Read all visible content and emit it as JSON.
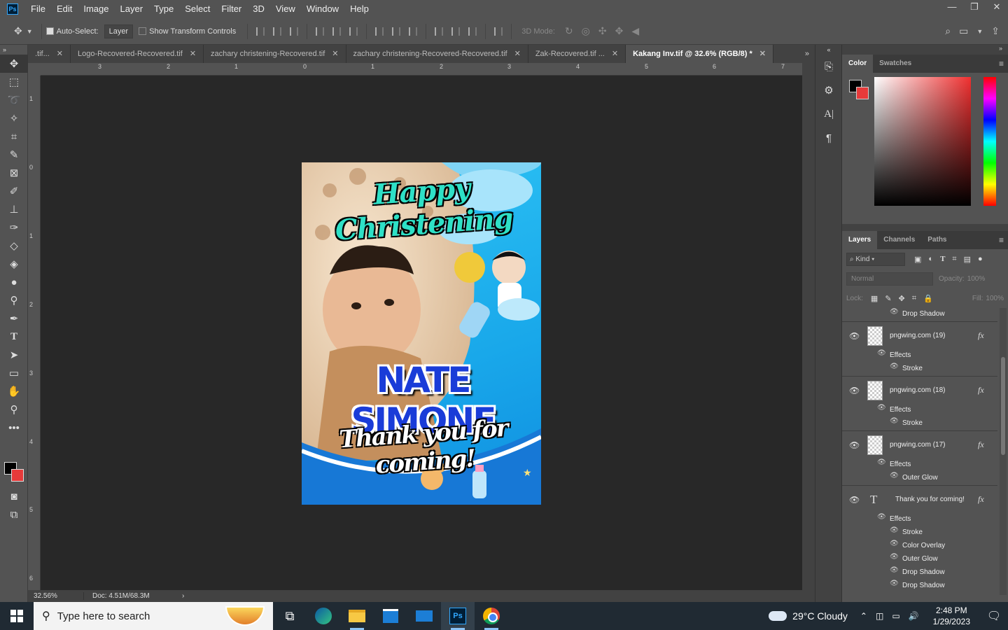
{
  "app": {
    "logo": "Ps"
  },
  "menu": [
    "File",
    "Edit",
    "Image",
    "Layer",
    "Type",
    "Select",
    "Filter",
    "3D",
    "View",
    "Window",
    "Help"
  ],
  "window_controls": {
    "minimize": "—",
    "restore": "❐",
    "close": "✕"
  },
  "options": {
    "auto_select_label": "Auto-Select:",
    "auto_select_target": "Layer",
    "show_transform_label": "Show Transform Controls",
    "mode_3d_label": "3D Mode:"
  },
  "tabs": [
    {
      "label": ".tif...",
      "close": "✕"
    },
    {
      "label": "Logo-Recovered-Recovered.tif",
      "close": "✕"
    },
    {
      "label": "zachary christening-Recovered.tif",
      "close": "✕"
    },
    {
      "label": "zachary christening-Recovered-Recovered.tif",
      "close": "✕"
    },
    {
      "label": "Zak-Recovered.tif ...",
      "close": "✕"
    },
    {
      "label": "Kakang Inv.tif @ 32.6% (RGB/8) *",
      "close": "✕"
    }
  ],
  "ruler_h": [
    "3",
    "2",
    "1",
    "0",
    "1",
    "2",
    "3",
    "4",
    "5",
    "6",
    "7"
  ],
  "ruler_v": [
    "1",
    "0",
    "1",
    "2",
    "3",
    "4",
    "5",
    "6"
  ],
  "status": {
    "zoom": "32.56%",
    "doc": "Doc: 4.51M/68.3M",
    "arrow": "›"
  },
  "document": {
    "headline": "Happy Christening",
    "name": "NATE SIMONE",
    "footer": "Thank you for coming!"
  },
  "color_panel": {
    "tabs": [
      "Color",
      "Swatches"
    ],
    "fg": "#000000",
    "bg": "#e63a3a"
  },
  "layers_panel": {
    "tabs": [
      "Layers",
      "Channels",
      "Paths"
    ],
    "kind_label": "Kind",
    "blend_mode": "Normal",
    "opacity_label": "Opacity:",
    "opacity_value": "100%",
    "lock_label": "Lock:",
    "fill_label": "Fill:",
    "fill_value": "100%",
    "top_effect": "Drop Shadow",
    "layers": [
      {
        "name": "pngwing.com (19)",
        "effects_label": "Effects",
        "effects": [
          "Stroke"
        ]
      },
      {
        "name": "pngwing.com (18)",
        "effects_label": "Effects",
        "effects": [
          "Stroke"
        ]
      },
      {
        "name": "pngwing.com (17)",
        "effects_label": "Effects",
        "effects": [
          "Outer Glow"
        ]
      },
      {
        "name": "Thank you for coming!",
        "effects_label": "Effects",
        "effects": [
          "Stroke",
          "Color Overlay",
          "Outer Glow",
          "Drop Shadow",
          "Drop Shadow"
        ]
      }
    ],
    "fx_label": "fx"
  },
  "taskbar": {
    "search_placeholder": "Type here to search",
    "weather": "29°C  Cloudy",
    "time": "2:48 PM",
    "date": "1/29/2023"
  }
}
